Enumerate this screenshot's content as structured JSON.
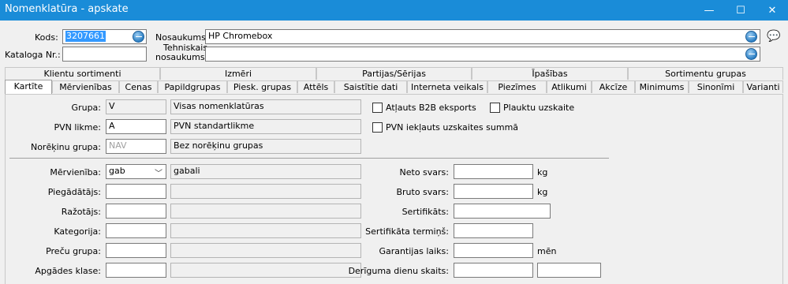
{
  "window": {
    "title": "Nomenklatūra - apskate",
    "min": "—",
    "max": "☐",
    "close": "✕"
  },
  "header": {
    "kods_label": "Kods:",
    "kods_value": "3207661",
    "kataloga_label": "Kataloga Nr.:",
    "kataloga_value": "",
    "nosaukums_label": "Nosaukums:",
    "nosaukums_value": "HP Chromebox",
    "tehniskais_label1": "Tehniskais",
    "tehniskais_label2": "nosaukums:",
    "tehniskais_value": ""
  },
  "tabs_top": [
    "Klientu sortimenti",
    "Izmēri",
    "Partijas/Sērijas",
    "Īpašības",
    "Sortimentu grupas"
  ],
  "tabs_bottom": [
    "Kartīte",
    "Mērvienības",
    "Cenas",
    "Papildgrupas",
    "Piesk. grupas",
    "Attēls",
    "Saistītie dati",
    "Interneta veikals",
    "Piezīmes",
    "Atlikumi",
    "Akcīze",
    "Minimums",
    "Sinonīmi",
    "Varianti"
  ],
  "card": {
    "grupa_label": "Grupa:",
    "grupa_code": "V",
    "grupa_name": "Visas nomenklatūras",
    "pvn_label": "PVN likme:",
    "pvn_code": "A",
    "pvn_name": "PVN standartlikme",
    "noreikinu_label": "Norēķinu grupa:",
    "noreikinu_code": "NAV",
    "noreikinu_name": "Bez norēķinu grupas",
    "b2b_label": "Atļauts B2B eksports",
    "plauktu_label": "Plauktu uzskaite",
    "pvn_ieklauts_label": "PVN iekļauts uzskaites summā",
    "mervieniba_label": "Mērvienība:",
    "mervieniba_value": "gab",
    "mervieniba_name": "gabali",
    "piegadatajs_label": "Piegādātājs:",
    "razotajs_label": "Ražotājs:",
    "kategorija_label": "Kategorija:",
    "precu_label": "Preču grupa:",
    "apgades_label": "Apgādes klase:",
    "neto_label": "Neto svars:",
    "neto_unit": "kg",
    "bruto_label": "Bruto svars:",
    "bruto_unit": "kg",
    "sertifikats_label": "Sertifikāts:",
    "sert_termins_label": "Sertifikāta termiņš:",
    "garantijas_label": "Garantijas laiks:",
    "garantijas_unit": "mēn",
    "deriguma_label": "Derīguma dienu skaits:"
  }
}
